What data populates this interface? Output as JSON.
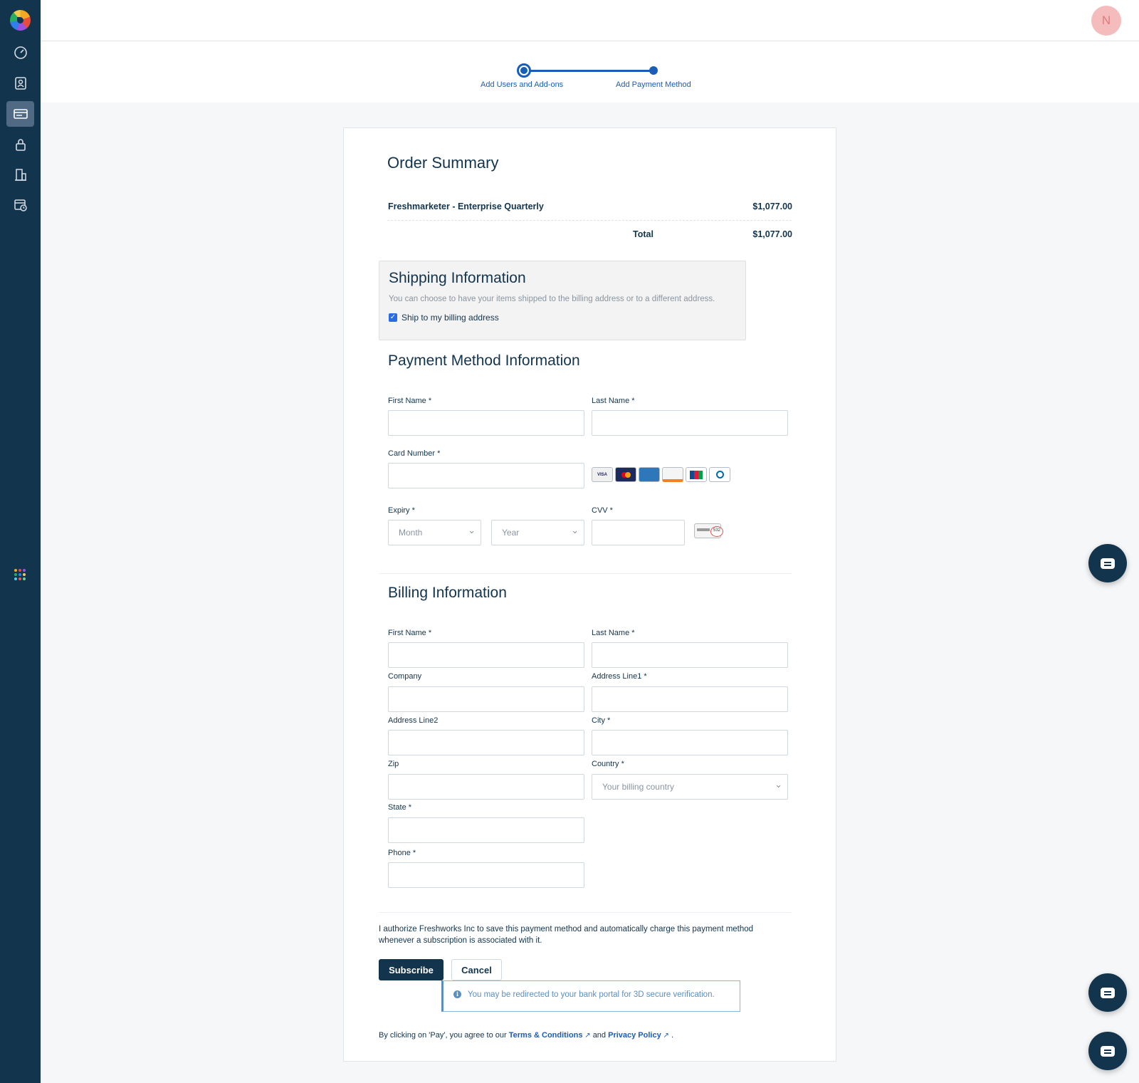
{
  "sidebar": {
    "items": [
      {
        "icon": "dashboard-icon"
      },
      {
        "icon": "contacts-icon"
      },
      {
        "icon": "billing-icon",
        "active": true
      },
      {
        "icon": "lock-icon"
      },
      {
        "icon": "building-icon"
      },
      {
        "icon": "calendar-clock-icon"
      }
    ],
    "apps_icon": "apps-grid-icon"
  },
  "topbar": {
    "avatar_initial": "N",
    "avatar_color": "#f4bcbc"
  },
  "stepper": {
    "step1": "Add Users and Add-ons",
    "step2": "Add Payment Method",
    "color": "#1a5db8"
  },
  "order_summary": {
    "title": "Order Summary",
    "item_name": "Freshmarketer - Enterprise Quarterly",
    "item_price": "$1,077.00",
    "total_label": "Total",
    "total_value": "$1,077.00"
  },
  "shipping": {
    "title": "Shipping Information",
    "description": "You can choose to have your items shipped to the billing address or to a different address.",
    "checkbox_label": "Ship to my billing address",
    "checked": true
  },
  "payment": {
    "title": "Payment Method Information",
    "first_name_label": "First Name *",
    "last_name_label": "Last Name *",
    "card_number_label": "Card Number *",
    "expiry_label": "Expiry *",
    "month_placeholder": "Month",
    "year_placeholder": "Year",
    "cvv_label": "CVV *",
    "card_brands": [
      "VISA",
      "MC",
      "AMEX",
      "DISCOVER",
      "JCB",
      "DINERS"
    ]
  },
  "billing": {
    "title": "Billing Information",
    "first_name_label": "First Name *",
    "last_name_label": "Last Name *",
    "company_label": "Company",
    "address1_label": "Address Line1 *",
    "address2_label": "Address Line2",
    "city_label": "City *",
    "zip_label": "Zip",
    "country_label": "Country *",
    "country_placeholder": "Your billing country",
    "state_label": "State *",
    "phone_label": "Phone *"
  },
  "authorization_text": "I authorize Freshworks Inc to save this payment method and automatically charge this payment method whenever a subscription is associated with it.",
  "buttons": {
    "subscribe": "Subscribe",
    "cancel": "Cancel"
  },
  "notice": "You may be redirected to your bank portal for 3D secure verification.",
  "footer": {
    "prefix": "By clicking on 'Pay', you agree to our",
    "terms": "Terms & Conditions",
    "and": "and",
    "privacy": "Privacy Policy",
    "suffix": "."
  }
}
